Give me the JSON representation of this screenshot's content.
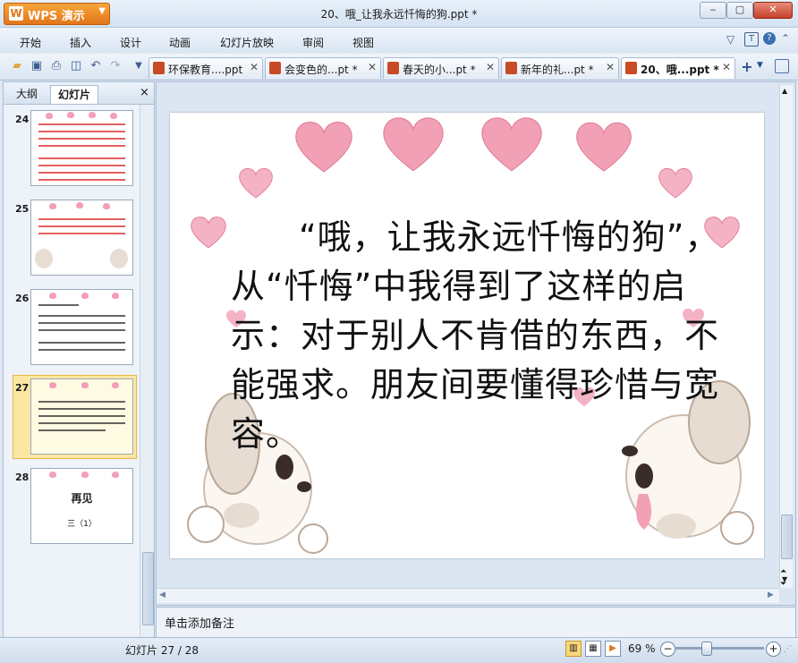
{
  "app": {
    "name": "WPS 演示",
    "window_title": "20、哦_让我永远忏悔的狗.ppt *"
  },
  "menu": [
    "开始",
    "插入",
    "设计",
    "动画",
    "幻灯片放映",
    "审阅",
    "视图"
  ],
  "doc_tabs": [
    {
      "label": "环保教育....ppt",
      "active": false
    },
    {
      "label": "会变色的...pt *",
      "active": false
    },
    {
      "label": "春天的小...pt *",
      "active": false
    },
    {
      "label": "新年的礼...pt *",
      "active": false
    },
    {
      "label": "20、哦...ppt *",
      "active": true
    }
  ],
  "panel": {
    "tab_outline": "大纲",
    "tab_slides": "幻灯片",
    "close": "×"
  },
  "thumbnails": [
    {
      "num": "24"
    },
    {
      "num": "25"
    },
    {
      "num": "26"
    },
    {
      "num": "27"
    },
    {
      "num": "28",
      "title": "再见",
      "caption": "三（1）"
    }
  ],
  "slide": {
    "text": "“哦，让我永远忏悔的狗”，从“忏悔”中我得到了这样的启示：对于别人不肯借的东西，不能强求。朋友间要懂得珍惜与宽容。"
  },
  "notes": {
    "placeholder": "单击添加备注"
  },
  "status": {
    "slide_counter": "幻灯片 27 / 28",
    "zoom": "69 %"
  },
  "colors": {
    "accent": "#e2761a",
    "heart": "#f2a0b5",
    "selected_thumb": "#fbe7a1"
  }
}
